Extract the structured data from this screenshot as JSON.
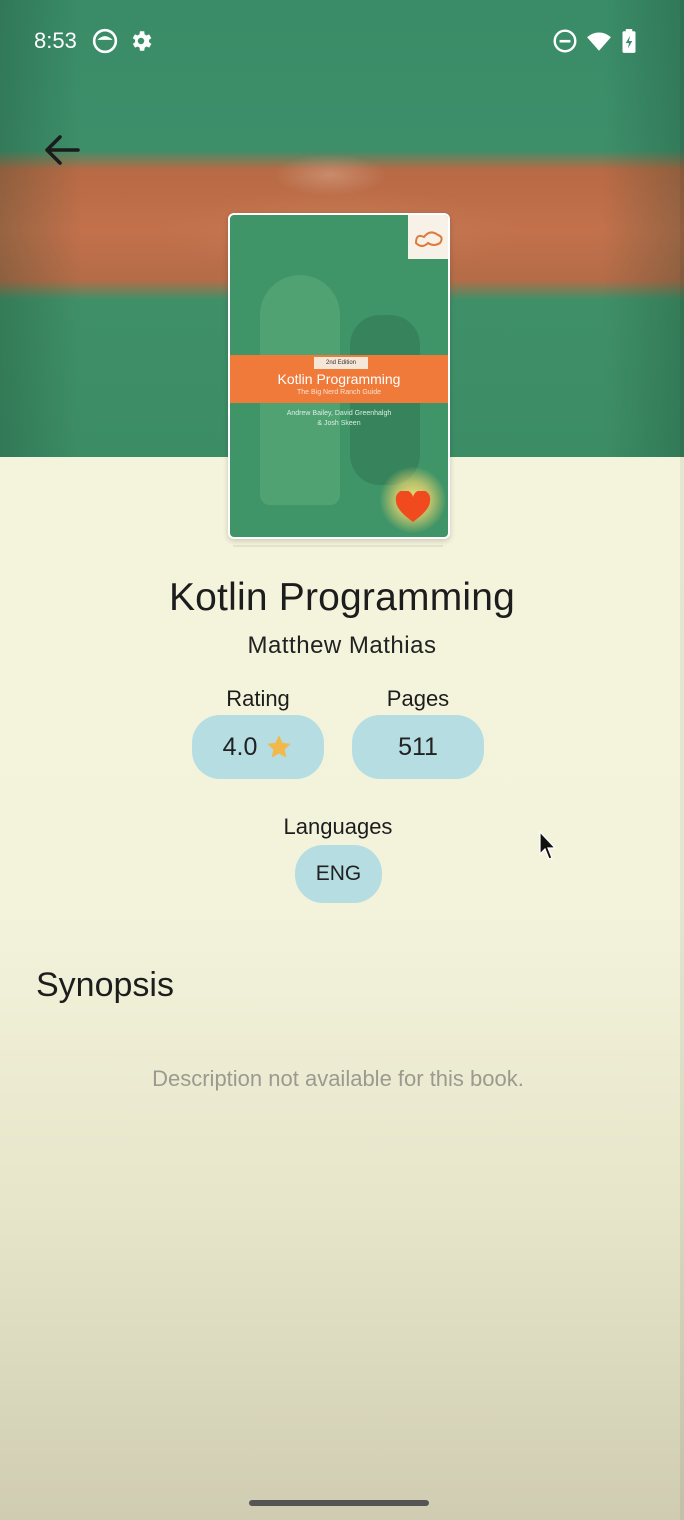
{
  "status_bar": {
    "time": "8:53",
    "icons": [
      "face-icon",
      "settings-gear-icon",
      "do-not-disturb-icon",
      "wifi-icon",
      "battery-charging-icon"
    ]
  },
  "navigation": {
    "back_icon": "arrow-back-icon"
  },
  "book": {
    "cover": {
      "edition": "2nd Edition",
      "title": "Kotlin Programming",
      "subtitle": "The Big Nerd Ranch Guide",
      "authors_line1": "Andrew Bailey, David Greenhalgh",
      "authors_line2": "& Josh Skeen",
      "favorite_icon": "heart-icon"
    },
    "title": "Kotlin Programming",
    "author": "Matthew Mathias",
    "rating_label": "Rating",
    "rating_value": "4.0",
    "rating_icon": "star-icon",
    "pages_label": "Pages",
    "pages_value": "511",
    "languages_label": "Languages",
    "languages": [
      "ENG"
    ]
  },
  "synopsis": {
    "heading": "Synopsis",
    "text": "Description not available for this book."
  },
  "colors": {
    "chip_background": "#b5dde2",
    "page_background": "#f5f5de",
    "star": "#f2b84a",
    "heart": "#f04a1e"
  }
}
